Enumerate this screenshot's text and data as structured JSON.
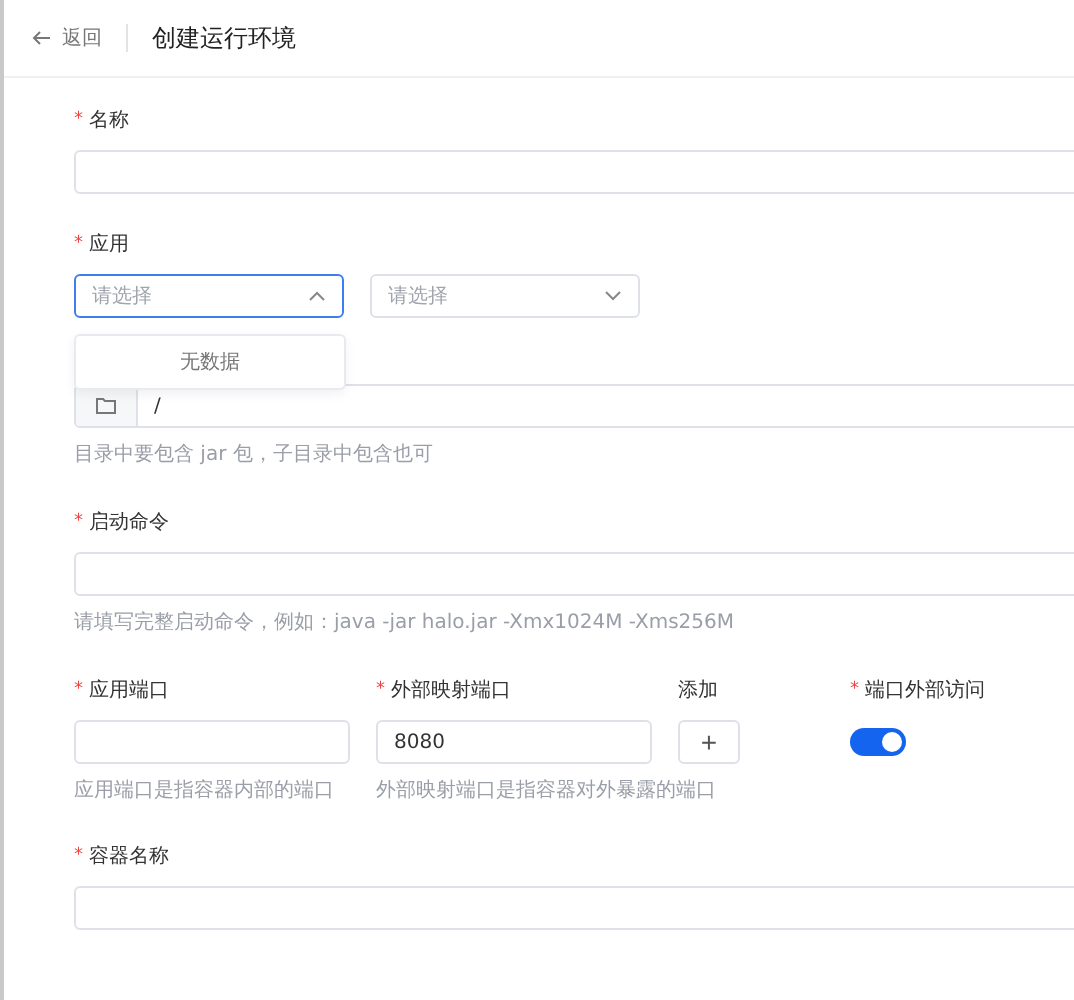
{
  "header": {
    "back": "返回",
    "title": "创建运行环境"
  },
  "name_field": {
    "label": "名称",
    "required_mark": "*"
  },
  "app": {
    "label": "应用",
    "required_mark": "*",
    "selects": [
      {
        "placeholder": "请选择",
        "open": true
      },
      {
        "placeholder": "请选择",
        "open": false
      }
    ],
    "dropdown": {
      "empty_text": "无数据"
    }
  },
  "directory": {
    "value": "/",
    "hint": "目录中要包含 jar 包，子目录中包含也可"
  },
  "command": {
    "label": "启动命令",
    "required_mark": "*",
    "hint": "请填写完整启动命令，例如：java -jar halo.jar -Xmx1024M -Xms256M"
  },
  "ports": {
    "app_port": {
      "label": "应用端口",
      "required_mark": "*",
      "hint": "应用端口是指容器内部的端口"
    },
    "external_port": {
      "label": "外部映射端口",
      "required_mark": "*",
      "value": "8080",
      "hint": "外部映射端口是指容器对外暴露的端口"
    },
    "add": {
      "label": "添加",
      "symbol": "+"
    },
    "external_access": {
      "label": "端口外部访问",
      "required_mark": "*",
      "on": true
    }
  },
  "container_name": {
    "label": "容器名称",
    "required_mark": "*"
  }
}
